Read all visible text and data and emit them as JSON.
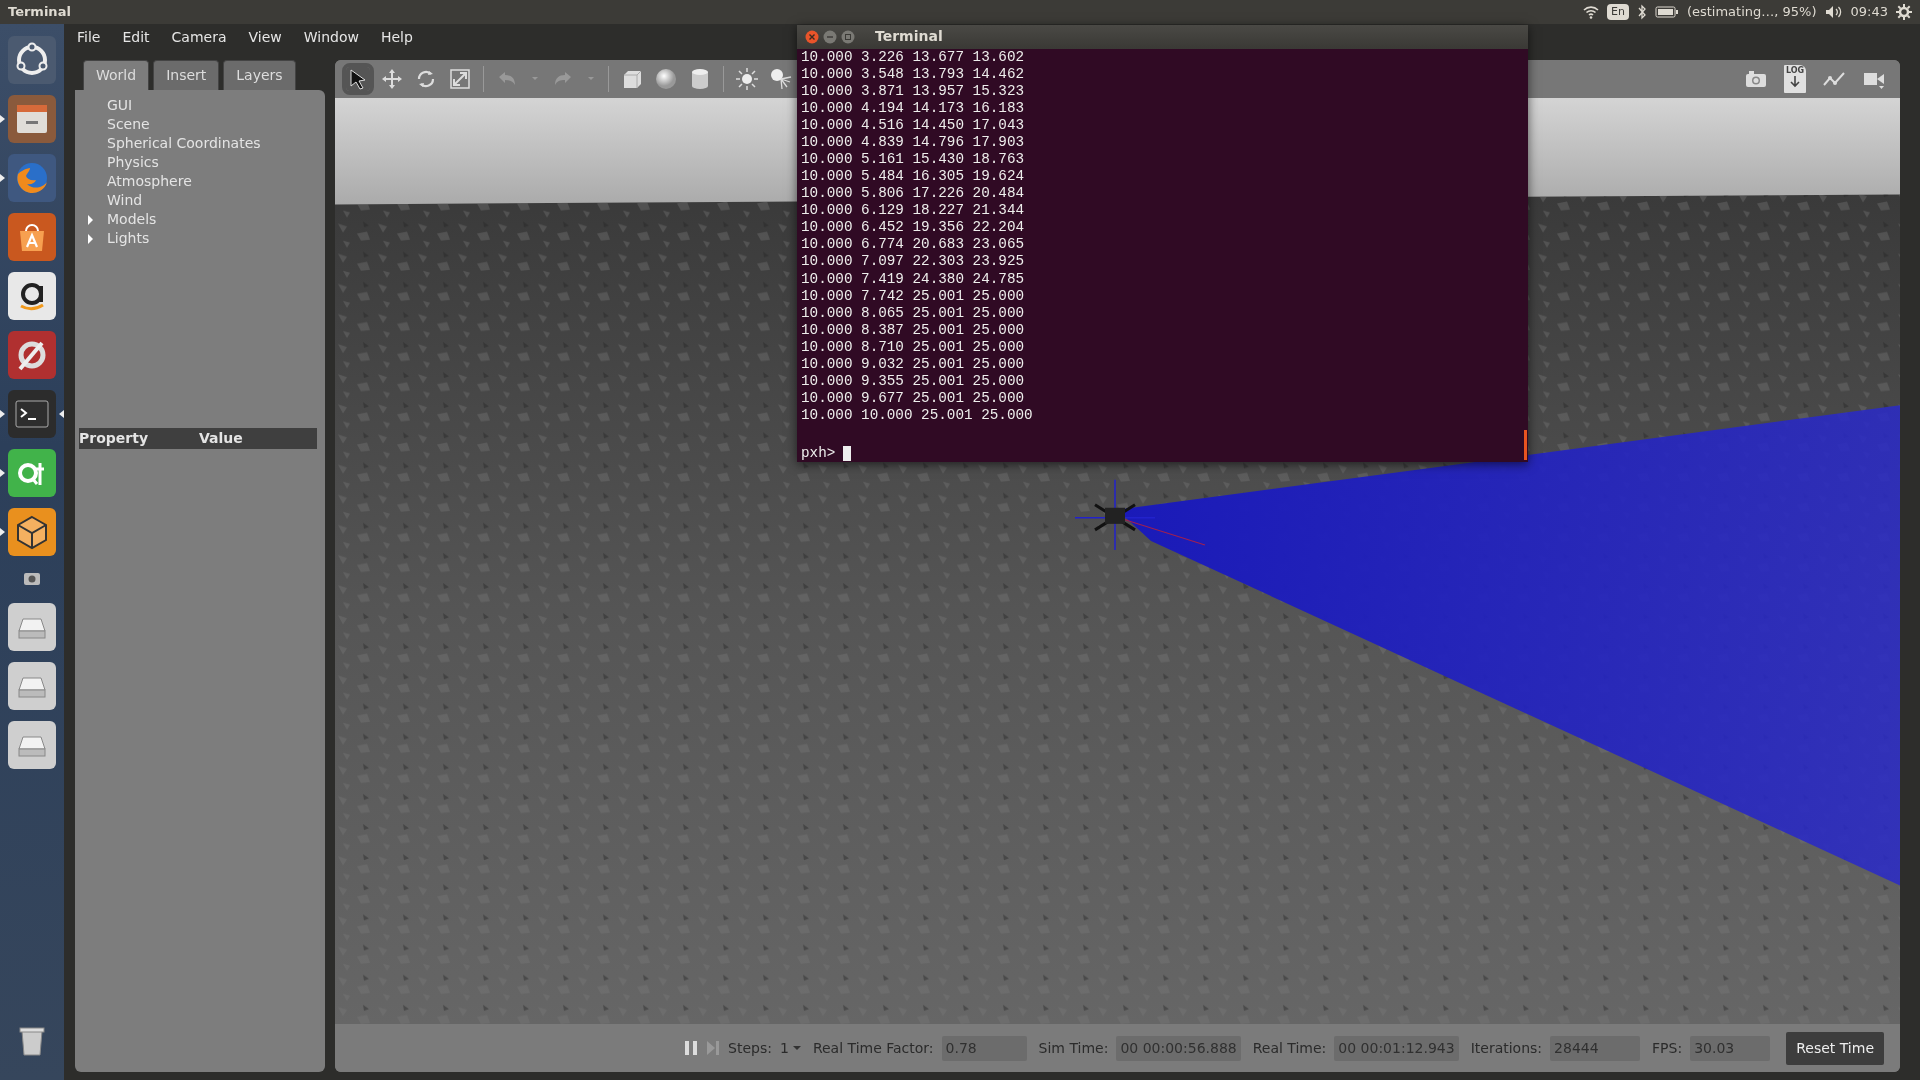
{
  "top_panel": {
    "app_title": "Terminal",
    "keyboard": "En",
    "battery": "(estimating…, 95%)",
    "clock": "09:43"
  },
  "launcher": [
    {
      "kind": "dash",
      "running": false,
      "focused": false
    },
    {
      "kind": "files",
      "running": true,
      "focused": false
    },
    {
      "kind": "browser",
      "running": true,
      "focused": false
    },
    {
      "kind": "store",
      "running": false,
      "focused": false
    },
    {
      "kind": "shop",
      "running": false,
      "focused": false
    },
    {
      "kind": "tools",
      "running": false,
      "focused": false
    },
    {
      "kind": "terminal",
      "running": true,
      "focused": true
    },
    {
      "kind": "qt",
      "running": true,
      "focused": false
    },
    {
      "kind": "cube",
      "running": true,
      "focused": false
    },
    {
      "kind": "camera",
      "running": false,
      "focused": false
    },
    {
      "kind": "drive",
      "running": false,
      "focused": false
    },
    {
      "kind": "drive",
      "running": false,
      "focused": false
    },
    {
      "kind": "drive",
      "running": false,
      "focused": false
    },
    {
      "kind": "trash",
      "running": false,
      "focused": false
    }
  ],
  "menu": [
    "File",
    "Edit",
    "Camera",
    "View",
    "Window",
    "Help"
  ],
  "left_panel": {
    "tabs": [
      {
        "label": "World",
        "selected": true
      },
      {
        "label": "Insert",
        "selected": false
      },
      {
        "label": "Layers",
        "selected": false
      }
    ],
    "tree": [
      {
        "label": "GUI",
        "kind": "leaf"
      },
      {
        "label": "Scene",
        "kind": "leaf"
      },
      {
        "label": "Spherical Coordinates",
        "kind": "leaf"
      },
      {
        "label": "Physics",
        "kind": "leaf"
      },
      {
        "label": "Atmosphere",
        "kind": "leaf"
      },
      {
        "label": "Wind",
        "kind": "leaf"
      },
      {
        "label": "Models",
        "kind": "group",
        "expanded": false
      },
      {
        "label": "Lights",
        "kind": "group",
        "expanded": false
      }
    ],
    "property_columns": [
      "Property",
      "Value"
    ]
  },
  "toolbar": [
    {
      "kind": "select",
      "selected": true
    },
    {
      "kind": "translate",
      "selected": false
    },
    {
      "kind": "rotate",
      "selected": false
    },
    {
      "kind": "scale",
      "selected": false
    },
    {
      "kind": "sep"
    },
    {
      "kind": "undo",
      "selected": false
    },
    {
      "kind": "drop",
      "selected": false
    },
    {
      "kind": "redo",
      "selected": false
    },
    {
      "kind": "drop",
      "selected": false
    },
    {
      "kind": "sep"
    },
    {
      "kind": "box",
      "selected": false
    },
    {
      "kind": "sphere",
      "selected": false
    },
    {
      "kind": "cylinder",
      "selected": false
    },
    {
      "kind": "sep"
    },
    {
      "kind": "pointlight",
      "selected": false
    },
    {
      "kind": "spotlight",
      "selected": false
    }
  ],
  "right_tools": [
    {
      "kind": "camera"
    },
    {
      "kind": "log",
      "label": "LOG"
    },
    {
      "kind": "plot"
    },
    {
      "kind": "video"
    }
  ],
  "terminal": {
    "title": "Terminal",
    "lines": [
      "10.000 3.226 13.677 13.602",
      "10.000 3.548 13.793 14.462",
      "10.000 3.871 13.957 15.323",
      "10.000 4.194 14.173 16.183",
      "10.000 4.516 14.450 17.043",
      "10.000 4.839 14.796 17.903",
      "10.000 5.161 15.430 18.763",
      "10.000 5.484 16.305 19.624",
      "10.000 5.806 17.226 20.484",
      "10.000 6.129 18.227 21.344",
      "10.000 6.452 19.356 22.204",
      "10.000 6.774 20.683 23.065",
      "10.000 7.097 22.303 23.925",
      "10.000 7.419 24.380 24.785",
      "10.000 7.742 25.001 25.000",
      "10.000 8.065 25.001 25.000",
      "10.000 8.387 25.001 25.000",
      "10.000 8.710 25.001 25.000",
      "10.000 9.032 25.001 25.000",
      "10.000 9.355 25.001 25.000",
      "10.000 9.677 25.001 25.000",
      "10.000 10.000 25.001 25.000"
    ],
    "prompt": "pxh>"
  },
  "bottom_bar": {
    "steps_label": "Steps:",
    "steps_value": "1",
    "fields": [
      {
        "label": "Real Time Factor:",
        "value": "0.78"
      },
      {
        "label": "Sim Time:",
        "value": "00 00:00:56.888"
      },
      {
        "label": "Real Time:",
        "value": "00 00:01:12.943"
      },
      {
        "label": "Iterations:",
        "value": "28444"
      },
      {
        "label": "FPS:",
        "value": "30.03"
      }
    ],
    "reset_button": "Reset Time"
  }
}
